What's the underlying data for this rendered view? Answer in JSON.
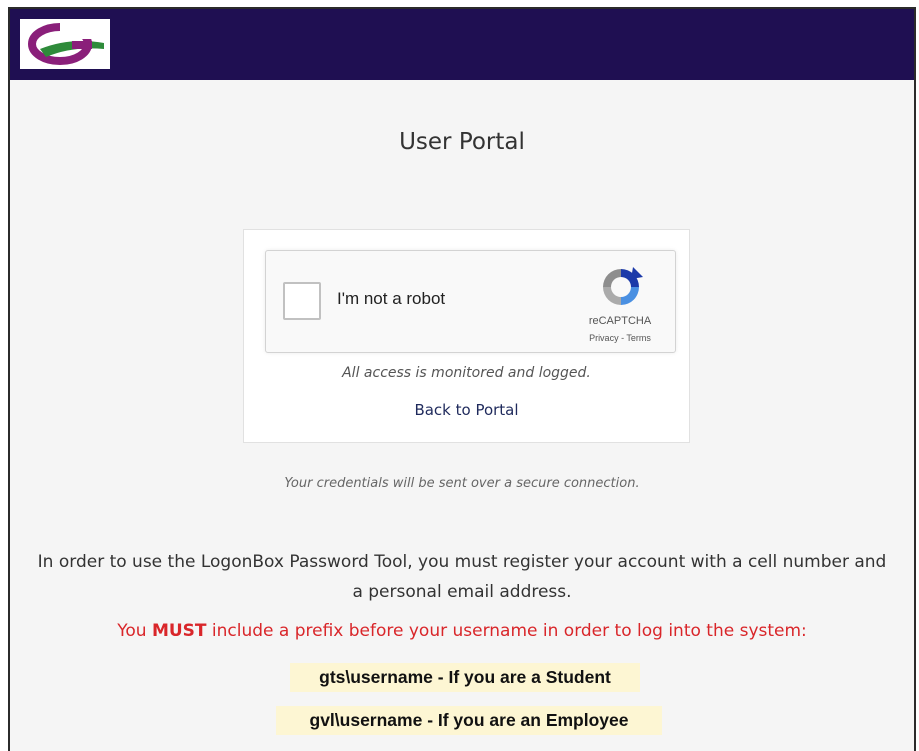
{
  "header": {
    "logo": "college-logo",
    "background_color": "#1f0f52"
  },
  "page": {
    "title": "User Portal"
  },
  "recaptcha": {
    "checkbox_label": "I'm not a robot",
    "brand": "reCAPTCHA",
    "privacy": "Privacy",
    "separator": " - ",
    "terms": "Terms",
    "icon": "recaptcha-icon"
  },
  "card": {
    "monitored_text": "All access is monitored and logged.",
    "back_link": "Back to Portal"
  },
  "secure_note": "Your credentials will be sent over a secure connection.",
  "info": {
    "register_text": "In order to use the LogonBox Password Tool, you must register your account with a cell number and a personal email address.",
    "warning_pre": "You ",
    "warning_strong": "MUST",
    "warning_post": " include a prefix before your username in order to log into the system:",
    "warning_color": "#d9262a",
    "prefix_student": "gts\\username - If you are a Student",
    "prefix_employee": "gvl\\username - If you are an Employee",
    "prefix_highlight_color": "#fdf6d3"
  }
}
